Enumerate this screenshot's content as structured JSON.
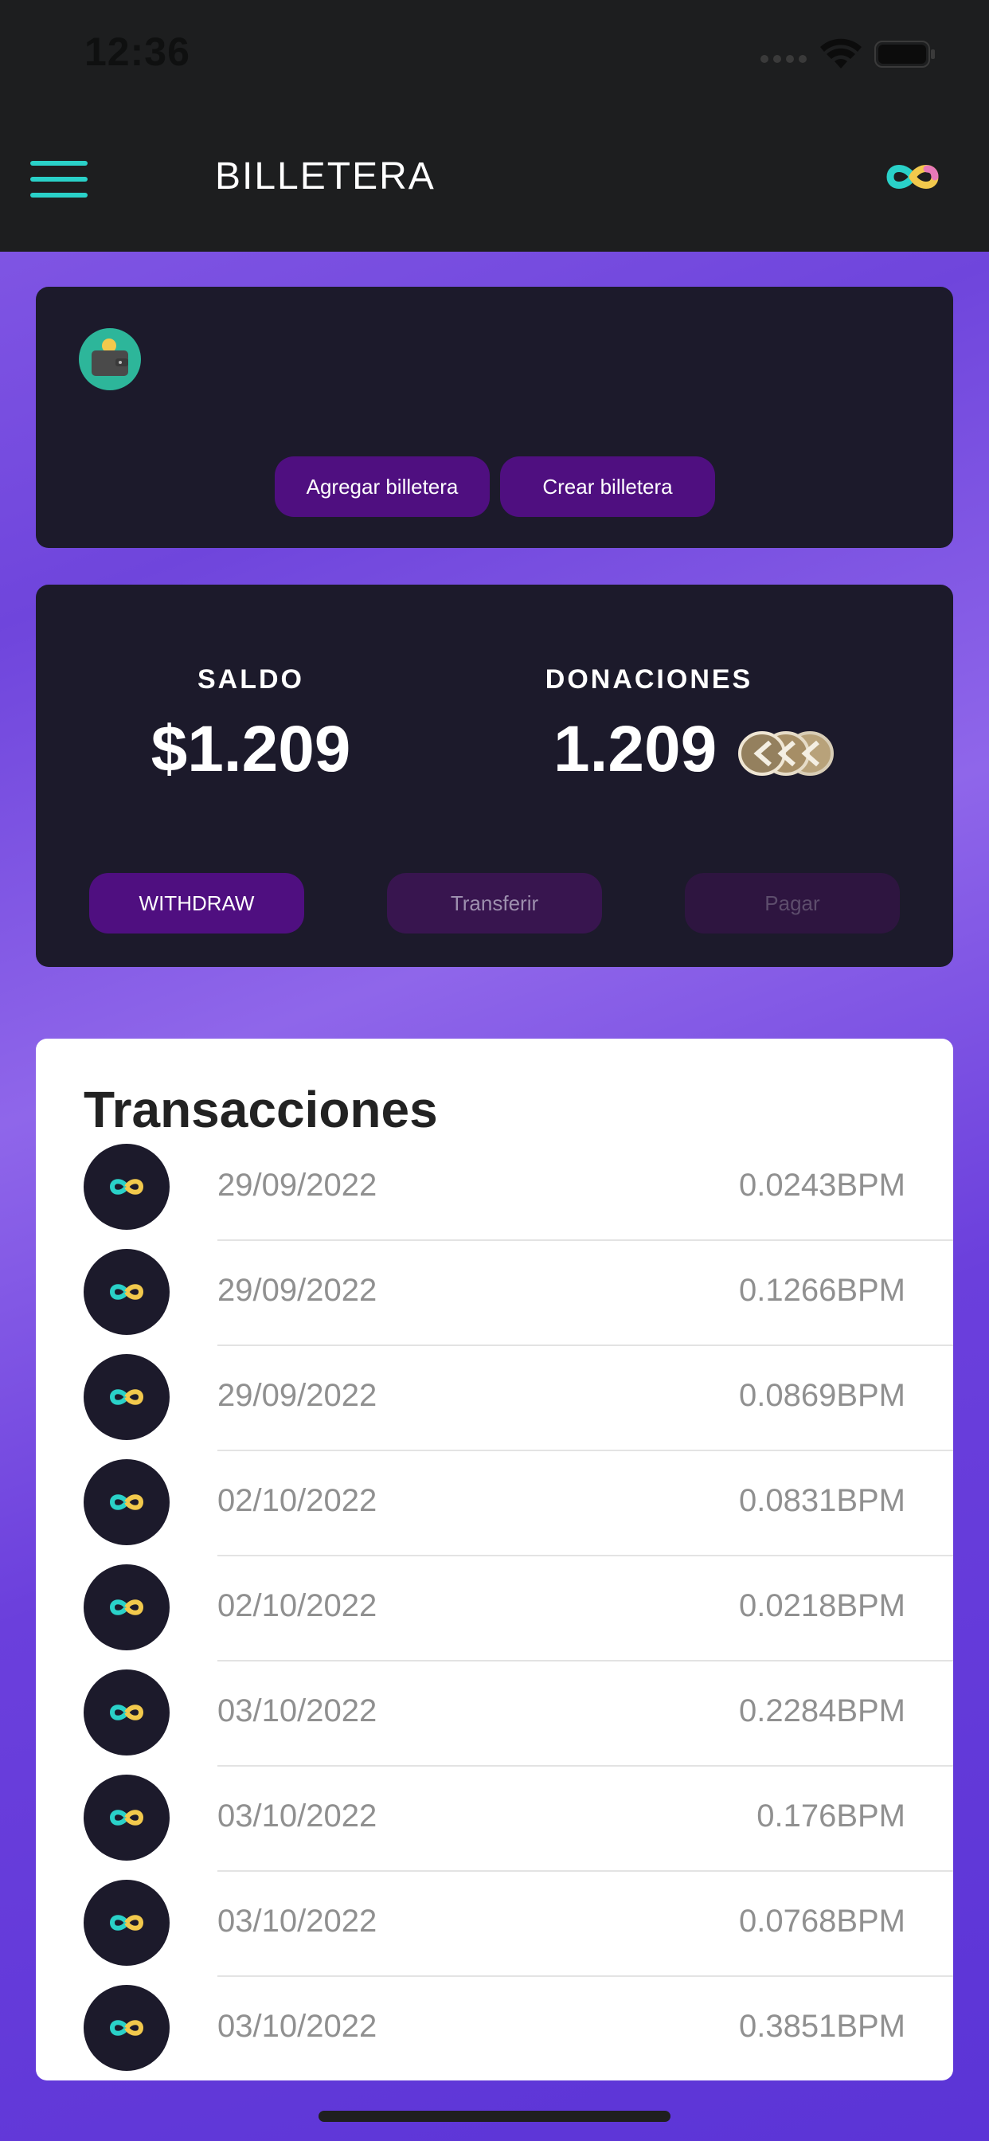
{
  "status_bar": {
    "time": "12:36"
  },
  "header": {
    "title": "BILLETERA",
    "menu_icon": "hamburger-icon",
    "brand_icon": "infinity-logo-icon"
  },
  "wallet": {
    "icon": "wallet-icon",
    "add_label": "Agregar billetera",
    "create_label": "Crear billetera"
  },
  "balance": {
    "saldo_label": "SALDO",
    "saldo_value": "$1.209",
    "donaciones_label": "DONACIONES",
    "donaciones_value": "1.209",
    "coin_icon": "coins-icon",
    "withdraw_label": "WITHDRAW",
    "transfer_label": "Transferir",
    "pay_label": "Pagar"
  },
  "transactions": {
    "title": "Transacciones",
    "items": [
      {
        "date": "29/09/2022",
        "amount": "0.0243BPM"
      },
      {
        "date": "29/09/2022",
        "amount": "0.1266BPM"
      },
      {
        "date": "29/09/2022",
        "amount": "0.0869BPM"
      },
      {
        "date": "02/10/2022",
        "amount": "0.0831BPM"
      },
      {
        "date": "02/10/2022",
        "amount": "0.0218BPM"
      },
      {
        "date": "03/10/2022",
        "amount": "0.2284BPM"
      },
      {
        "date": "03/10/2022",
        "amount": "0.176BPM"
      },
      {
        "date": "03/10/2022",
        "amount": "0.0768BPM"
      },
      {
        "date": "03/10/2022",
        "amount": "0.3851BPM"
      }
    ]
  },
  "colors": {
    "accent_teal": "#2ad1c8",
    "accent_yellow": "#f2c94c",
    "button_purple": "#4f0f80",
    "card_dark": "#1c1a2b",
    "header_dark": "#1d1e1f"
  }
}
